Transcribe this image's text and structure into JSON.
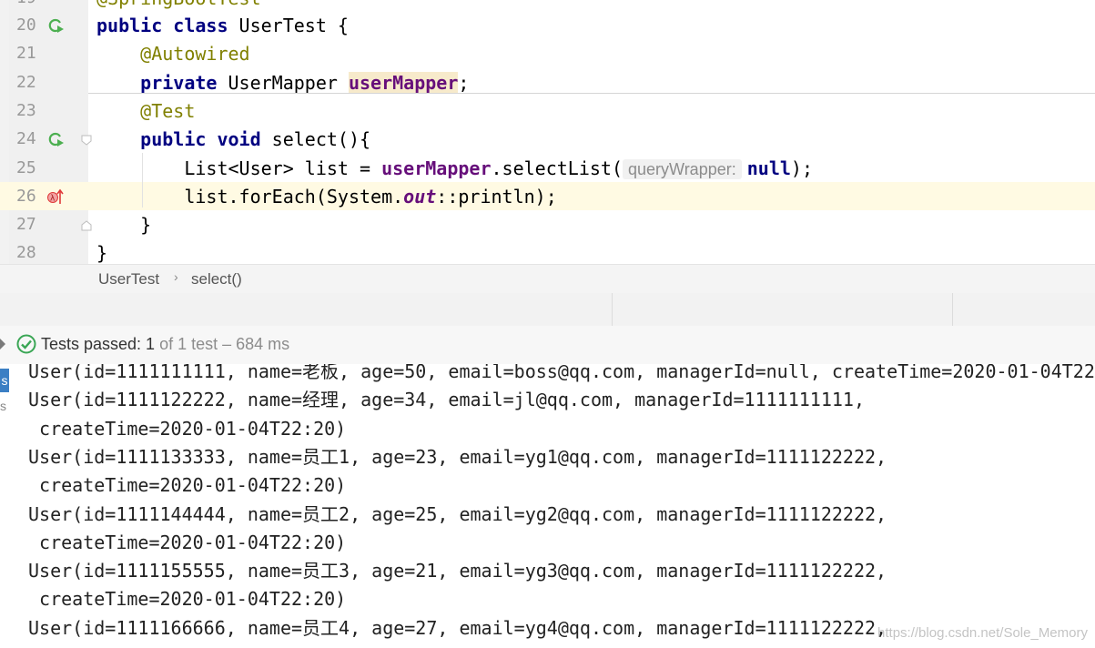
{
  "editor": {
    "partial_top_text": "@SpringBootTest",
    "lines": [
      {
        "num": "20",
        "code": [
          {
            "t": "public",
            "c": "kw"
          },
          {
            "t": " "
          },
          {
            "t": "class",
            "c": "kw"
          },
          {
            "t": " UserTest {"
          }
        ]
      },
      {
        "num": "21",
        "code": [
          {
            "t": "    "
          },
          {
            "t": "@Autowired",
            "c": "ann"
          }
        ]
      },
      {
        "num": "22",
        "code": [
          {
            "t": "    "
          },
          {
            "t": "private",
            "c": "kw"
          },
          {
            "t": " UserMapper "
          },
          {
            "t": "userMapper",
            "c": "field sel-hl"
          },
          {
            "t": ";"
          }
        ]
      },
      {
        "num": "23",
        "code": [
          {
            "t": "    "
          },
          {
            "t": "@Test",
            "c": "ann"
          }
        ]
      },
      {
        "num": "24",
        "code": [
          {
            "t": "    "
          },
          {
            "t": "public",
            "c": "kw"
          },
          {
            "t": " "
          },
          {
            "t": "void",
            "c": "kw"
          },
          {
            "t": " select(){"
          }
        ]
      },
      {
        "num": "25",
        "code": [
          {
            "t": "        List<User> list = "
          },
          {
            "t": "userMapper",
            "c": "field"
          },
          {
            "t": ".selectList("
          },
          {
            "t": "queryWrapper:",
            "c": "hint"
          },
          {
            "t": "null",
            "c": "kw"
          },
          {
            "t": ");"
          }
        ]
      },
      {
        "num": "26",
        "code": [
          {
            "t": "        list.forEach(System."
          },
          {
            "t": "out",
            "c": "static-italic"
          },
          {
            "t": "::println);"
          }
        ]
      },
      {
        "num": "27",
        "code": [
          {
            "t": "    }"
          }
        ]
      },
      {
        "num": "28",
        "code": [
          {
            "t": "}"
          }
        ]
      }
    ]
  },
  "breadcrumb": {
    "class_name": "UserTest",
    "method_name": "select()"
  },
  "status": {
    "label": "Tests passed: 1",
    "detail": "of 1 test – 684 ms"
  },
  "side_tab": {
    "active_letter": "s",
    "inactive_letter": "s"
  },
  "console": {
    "lines": [
      "User(id=1111111111, name=老板, age=50, email=boss@qq.com, managerId=null, createTime=2020-01-04T22",
      "User(id=1111122222, name=经理, age=34, email=jl@qq.com, managerId=1111111111,",
      " createTime=2020-01-04T22:20)",
      "User(id=1111133333, name=员工1, age=23, email=yg1@qq.com, managerId=1111122222,",
      " createTime=2020-01-04T22:20)",
      "User(id=1111144444, name=员工2, age=25, email=yg2@qq.com, managerId=1111122222,",
      " createTime=2020-01-04T22:20)",
      "User(id=1111155555, name=员工3, age=21, email=yg3@qq.com, managerId=1111122222,",
      " createTime=2020-01-04T22:20)",
      "User(id=1111166666, name=员工4, age=27, email=yg4@qq.com, managerId=1111122222,"
    ]
  },
  "watermark": "https://blog.csdn.net/Sole_Memory",
  "colors": {
    "keyword": "#000080",
    "annotation": "#808000",
    "field": "#660e7a",
    "pass_green": "#3aa655",
    "error_red": "#e03a3a"
  }
}
